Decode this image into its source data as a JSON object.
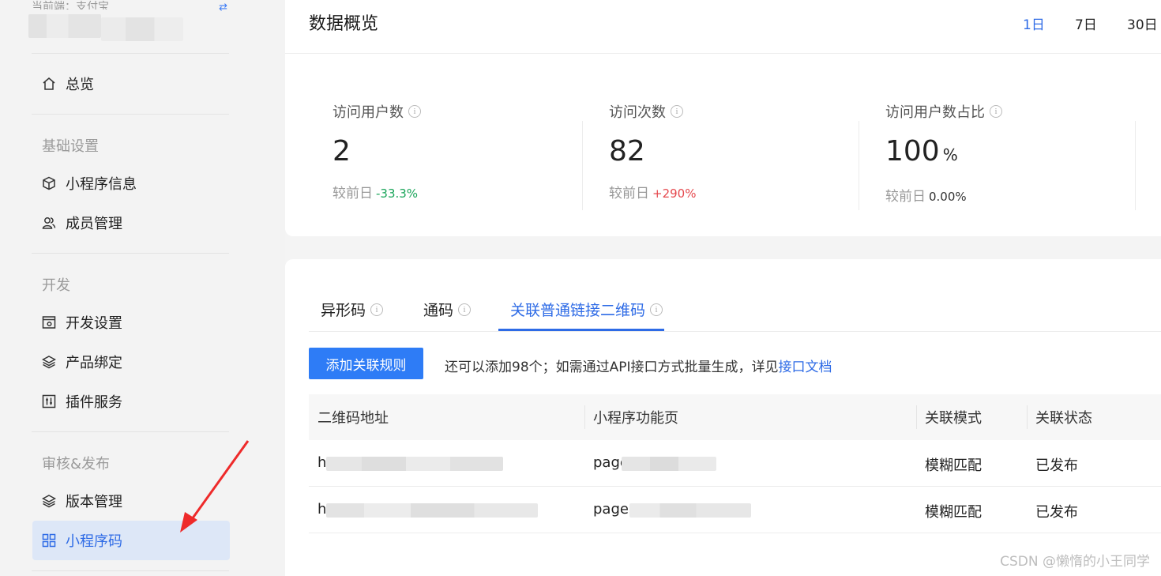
{
  "sidebar": {
    "endpoint": "当前端：支付宝",
    "overview": "总览",
    "sections": [
      {
        "title": "基础设置",
        "items": [
          "小程序信息",
          "成员管理"
        ]
      },
      {
        "title": "开发",
        "items": [
          "开发设置",
          "产品绑定",
          "插件服务"
        ]
      },
      {
        "title": "审核&发布",
        "items": [
          "版本管理",
          "小程序码"
        ]
      }
    ],
    "active_item": "小程序码"
  },
  "header": {
    "title": "数据概览",
    "ranges": [
      "1日",
      "7日",
      "30日"
    ],
    "active_range": "1日"
  },
  "stats": [
    {
      "label": "访问用户数",
      "value": "2",
      "unit": "",
      "compare_label": "较前日",
      "delta": "-33.3%",
      "delta_color": "#1aa55a"
    },
    {
      "label": "访问次数",
      "value": "82",
      "unit": "",
      "compare_label": "较前日",
      "delta": "+290%",
      "delta_color": "#e5484d"
    },
    {
      "label": "访问用户数占比",
      "value": "100",
      "unit": "%",
      "compare_label": "较前日",
      "delta": "0.00%",
      "delta_color": "#333333"
    }
  ],
  "tabs": {
    "items": [
      "异形码",
      "通码",
      "关联普通链接二维码"
    ],
    "active": "关联普通链接二维码"
  },
  "toolbar": {
    "add_button": "添加关联规则",
    "hint": "还可以添加98个；如需通过API接口方式批量生成，详见",
    "hint_link": "接口文档"
  },
  "table": {
    "headers": [
      "二维码地址",
      "小程序功能页",
      "关联模式",
      "关联状态"
    ],
    "rows": [
      {
        "url": "h",
        "page": "page",
        "mode": "模糊匹配",
        "status": "已发布"
      },
      {
        "url": "h",
        "page": "pages",
        "mode": "模糊匹配",
        "status": "已发布"
      }
    ]
  },
  "watermark": "CSDN @懒惰的小王同学",
  "colors": {
    "accent": "#2e6be6",
    "button": "#2e7cf6"
  }
}
